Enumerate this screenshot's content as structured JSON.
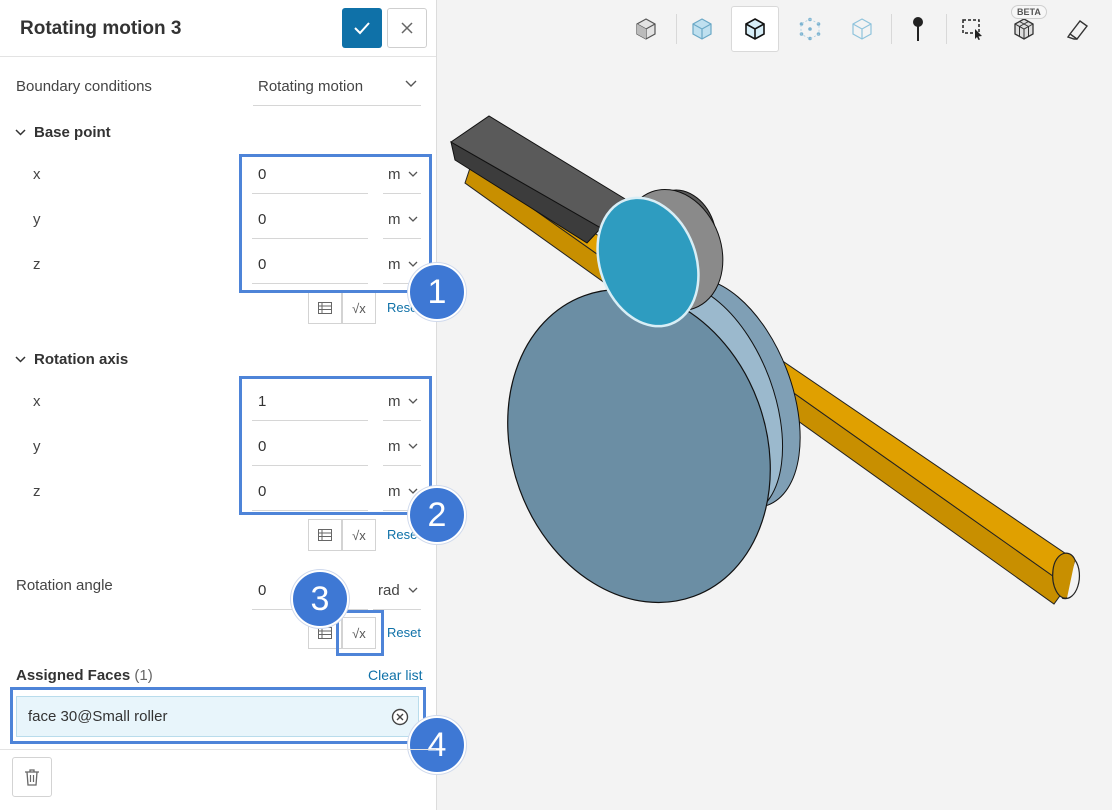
{
  "panel": {
    "title": "Rotating motion 3",
    "boundary_conditions": {
      "label": "Boundary conditions",
      "value": "Rotating motion"
    },
    "base_point": {
      "title": "Base point",
      "rows": [
        {
          "axis": "x",
          "value": "0",
          "unit": "m"
        },
        {
          "axis": "y",
          "value": "0",
          "unit": "m"
        },
        {
          "axis": "z",
          "value": "0",
          "unit": "m"
        }
      ],
      "reset_label": "Reset"
    },
    "rotation_axis": {
      "title": "Rotation axis",
      "rows": [
        {
          "axis": "x",
          "value": "1",
          "unit": "m"
        },
        {
          "axis": "y",
          "value": "0",
          "unit": "m"
        },
        {
          "axis": "z",
          "value": "0",
          "unit": "m"
        }
      ],
      "reset_label": "Reset"
    },
    "rotation_angle": {
      "label": "Rotation angle",
      "value": "0",
      "unit": "rad",
      "reset_label": "Reset"
    },
    "formula_symbol": "√x",
    "assigned": {
      "title": "Assigned Faces",
      "count": "(1)",
      "clear_label": "Clear list",
      "items": [
        "face 30@Small roller"
      ]
    }
  },
  "annotations": [
    "1",
    "2",
    "3",
    "4"
  ],
  "viewer": {
    "beta_label": "BETA"
  },
  "colors": {
    "primary": "#0f71a8",
    "highlight": "#4e84d8",
    "shaft": "#e0a000",
    "disc": "#6b8ea4",
    "small_disc": "#2e9cc0",
    "bar": "#5a5a5a"
  },
  "icons": [
    "check-icon",
    "close-icon",
    "chevron-down-icon",
    "table-icon",
    "formula-icon",
    "trash-icon",
    "clear-circle-icon"
  ]
}
